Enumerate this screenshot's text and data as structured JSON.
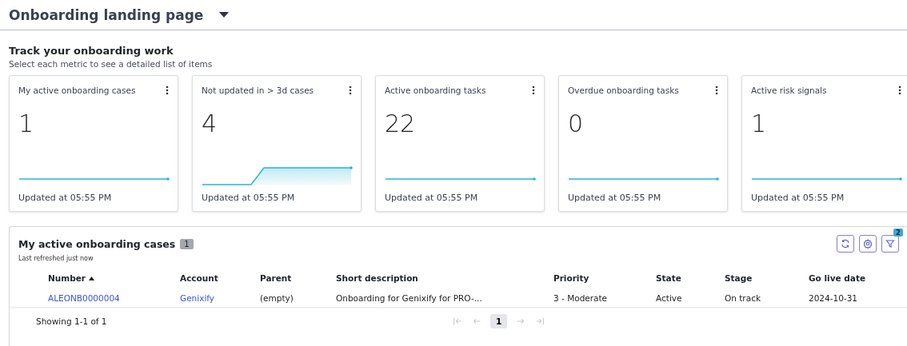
{
  "page_title": "Onboarding landing page",
  "section": {
    "title": "Track your onboarding work",
    "subtitle": "Select each metric to see a detailed list of items"
  },
  "metrics": [
    {
      "label": "My active onboarding cases",
      "value": "1",
      "kind": "flat",
      "updated": "Updated at 05:55 PM"
    },
    {
      "label": "Not updated in > 3d cases",
      "value": "4",
      "kind": "rise",
      "updated": "Updated at 05:55 PM"
    },
    {
      "label": "Active onboarding tasks",
      "value": "22",
      "kind": "flat",
      "updated": "Updated at 05:55 PM"
    },
    {
      "label": "Overdue onboarding tasks",
      "value": "0",
      "kind": "flat",
      "updated": "Updated at 05:55 PM"
    },
    {
      "label": "Active risk signals",
      "value": "1",
      "kind": "flat",
      "updated": "Updated at 05:55 PM"
    }
  ],
  "list": {
    "title": "My active onboarding cases",
    "count": "1",
    "refreshed": "Last refreshed just now",
    "filter_count": "2",
    "columns": [
      {
        "label": "Number",
        "sorted": true
      },
      {
        "label": "Account",
        "sorted": false
      },
      {
        "label": "Parent",
        "sorted": false
      },
      {
        "label": "Short description",
        "sorted": false
      },
      {
        "label": "Priority",
        "sorted": false
      },
      {
        "label": "State",
        "sorted": false
      },
      {
        "label": "Stage",
        "sorted": false
      },
      {
        "label": "Go live date",
        "sorted": false
      }
    ],
    "rows": [
      [
        {
          "text": "ALEONB0000004",
          "kind": "link"
        },
        {
          "text": "Genixify",
          "kind": "link"
        },
        {
          "text": "(empty)",
          "kind": "text"
        },
        {
          "text": "Onboarding for Genixify for PRO-...",
          "kind": "text"
        },
        {
          "text": "3 - Moderate",
          "kind": "text"
        },
        {
          "text": "Active",
          "kind": "text"
        },
        {
          "text": "On track",
          "kind": "text"
        },
        {
          "text": "2024-10-31",
          "kind": "text"
        }
      ]
    ],
    "showing": "Showing 1-1 of 1",
    "pager": [
      {
        "kind": "first",
        "disabled": true
      },
      {
        "kind": "prev",
        "disabled": true
      },
      {
        "kind": "page",
        "label": "1",
        "selected": true
      },
      {
        "kind": "next",
        "disabled": true
      },
      {
        "kind": "last",
        "disabled": true
      }
    ]
  }
}
